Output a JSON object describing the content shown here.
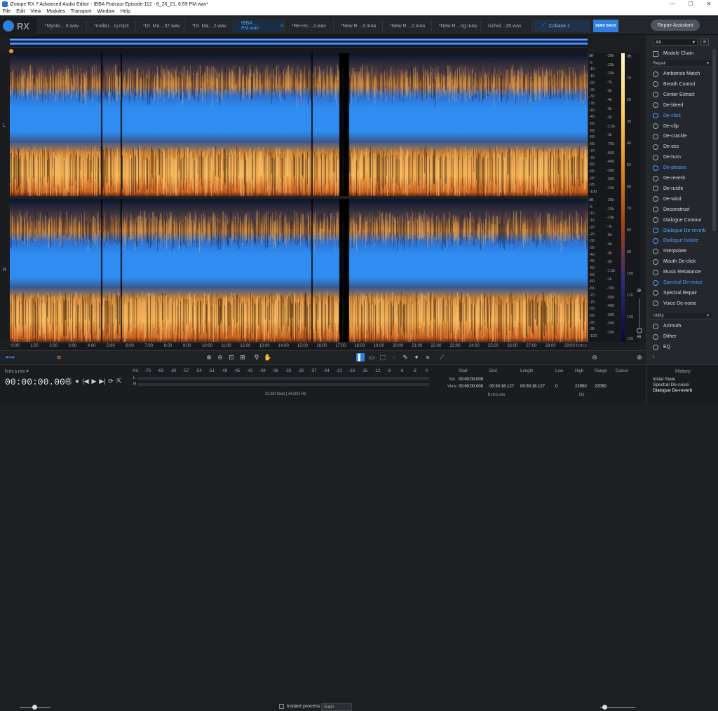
{
  "window": {
    "title": "iZotope RX 7 Advanced Audio Editor - IBBA Podcast Episode 112 - 8_26_21, 6.59 PM.wav*",
    "controls": [
      "—",
      "☐",
      "✕"
    ]
  },
  "menu": [
    "File",
    "Edit",
    "View",
    "Modules",
    "Transport",
    "Window",
    "Help"
  ],
  "logo": "RX",
  "tabs": [
    {
      "label": "*Mystic…rt.wav"
    },
    {
      "label": "*mallor…ry.mp3"
    },
    {
      "label": "*Dr. Ma…37.wav"
    },
    {
      "label": "*Dr. Ma…2.wav"
    },
    {
      "label": "IBBA …PM.wav",
      "active": true
    },
    {
      "label": "*Re-rec…2.wav"
    },
    {
      "label": "*New R…3.m4a"
    },
    {
      "label": "*New R…2.m4a"
    },
    {
      "label": "*New R…ng.m4a"
    },
    {
      "label": "nichol…26.wav"
    },
    {
      "label": "Cobase 1"
    }
  ],
  "send_back": "SEND BACK",
  "repair_assistant": "Repair Assistant",
  "channels": [
    "L",
    "R"
  ],
  "freq_labels": [
    "-20k",
    "-15k",
    "-10k",
    "-7k",
    "-5k",
    "-4k",
    "-3k",
    "-2k",
    "-1.5k",
    "-1k",
    "-700",
    "-500",
    "-400",
    "-300",
    "-200",
    "-100"
  ],
  "db_left": [
    "dB",
    "-5",
    "-10",
    "-15",
    "-20",
    "-25",
    "-30",
    "-35",
    "-40",
    "-45",
    "-50",
    "-55",
    "-60",
    "-65",
    "-70",
    "-75",
    "-80",
    "-85",
    "-90",
    "-95",
    "-100"
  ],
  "db_right": [
    "dB",
    "10",
    "20",
    "30",
    "40",
    "50",
    "60",
    "70",
    "80",
    "90",
    "100",
    "110",
    "120",
    "125"
  ],
  "timeline": [
    "0:00",
    "1:00",
    "2:00",
    "3:00",
    "4:00",
    "5:00",
    "6:00",
    "7:00",
    "8:00",
    "9:00",
    "10:00",
    "11:00",
    "12:00",
    "13:00",
    "14:00",
    "15:00",
    "16:00",
    "17:00",
    "18:00",
    "19:00",
    "20:00",
    "21:00",
    "22:00",
    "23:00",
    "24:00",
    "25:00",
    "26:00",
    "27:00",
    "28:00",
    "29:00",
    "h:m:s"
  ],
  "toolbar": {
    "instant_process": "Instant process",
    "gain": "Gain"
  },
  "bottom": {
    "time_format": "h:m:s.ms ▾",
    "timecode": "00:00:00.000",
    "transport": [
      "🎧",
      "●",
      "|◀",
      "▶",
      "▶|",
      "⟳",
      "⇱"
    ],
    "meter_scale": [
      "-Inf.",
      "-70",
      "-63",
      "-60",
      "-57",
      "-54",
      "-51",
      "-48",
      "-45",
      "-42",
      "-39",
      "-36",
      "-33",
      "-30",
      "-27",
      "-24",
      "-21",
      "-18",
      "-15",
      "-12",
      "-9",
      "-6",
      "-3",
      "0"
    ],
    "meter_labels": [
      "L",
      "R"
    ],
    "format": "32-bit float | 44100 Hz",
    "sel_label": "Sel",
    "view_label": "View",
    "start_header": "Start",
    "end_header": "End",
    "length_header": "Length",
    "low_header": "Low",
    "high_header": "High",
    "range_header": "Range",
    "cursor_header": "Cursor",
    "sel_start": "00:00:00.000",
    "view_start": "00:00:00.000",
    "view_end": "00:30:16.127",
    "view_length": "00:30:16.127",
    "view_low": "0",
    "view_high": "22050",
    "view_range": "22050",
    "time_unit": "h:m:s.ms",
    "freq_unit": "Hz"
  },
  "history": {
    "title": "History",
    "entries": [
      "Initial State",
      "Spectral De-noise",
      "Dialogue De-reverb"
    ]
  },
  "panel": {
    "filter": "All",
    "module_chain": "Module Chain",
    "repair_label": "Repair",
    "utility_label": "Utility",
    "repair_modules": [
      {
        "label": "Ambience Match"
      },
      {
        "label": "Breath Control"
      },
      {
        "label": "Center Extract"
      },
      {
        "label": "De-bleed"
      },
      {
        "label": "De-click",
        "hl": true
      },
      {
        "label": "De-clip"
      },
      {
        "label": "De-crackle"
      },
      {
        "label": "De-ess"
      },
      {
        "label": "De-hum"
      },
      {
        "label": "De-plosive",
        "hl": true
      },
      {
        "label": "De-reverb"
      },
      {
        "label": "De-rustle"
      },
      {
        "label": "De-wind"
      },
      {
        "label": "Deconstruct"
      },
      {
        "label": "Dialogue Contour"
      },
      {
        "label": "Dialogue De-reverb",
        "hl": true
      },
      {
        "label": "Dialogue Isolate",
        "hl": true
      },
      {
        "label": "Interpolate"
      },
      {
        "label": "Mouth De-click"
      },
      {
        "label": "Music Rebalance"
      },
      {
        "label": "Spectral De-noise",
        "hl": true
      },
      {
        "label": "Spectral Repair"
      },
      {
        "label": "Voice De-noise"
      }
    ],
    "utility_modules": [
      {
        "label": "Azimuth"
      },
      {
        "label": "Dither"
      },
      {
        "label": "EQ"
      }
    ]
  },
  "colors": {
    "accent": "#2d7fe0",
    "highlight": "#4aa3ff",
    "spec_blue": "#2f8cf0",
    "spec_orange": "#e89030"
  }
}
